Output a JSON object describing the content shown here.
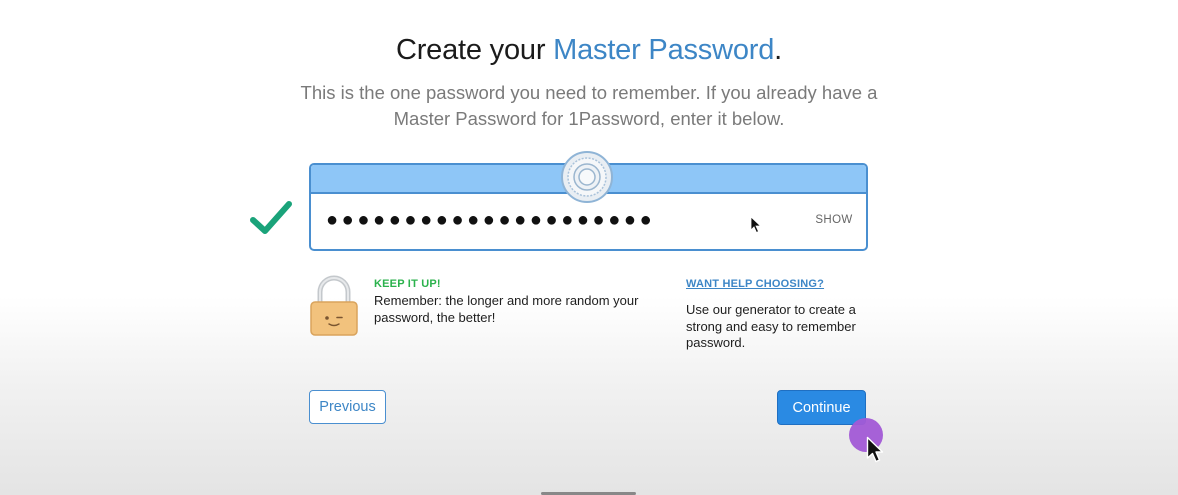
{
  "header": {
    "title_prefix": "Create your ",
    "title_accent": "Master Password",
    "title_suffix": ".",
    "subtitle": "This is the one password you need to remember. If you already have a Master Password for 1Password, enter it below."
  },
  "password_field": {
    "value_masked": "●●●●●●●●●●●●●●●●●●●●●",
    "show_label": "SHOW",
    "strength_status": "valid"
  },
  "tip": {
    "heading": "KEEP IT UP!",
    "body": "Remember: the longer and more random your password, the better!"
  },
  "help": {
    "link": "WANT HELP CHOOSING?",
    "body": "Use our generator to create a strong and easy to remember password."
  },
  "buttons": {
    "previous": "Previous",
    "continue": "Continue"
  },
  "colors": {
    "accent": "#3d86c6",
    "success": "#2bb24c",
    "check": "#1aa37a",
    "primary_button": "#2a8ae3",
    "field_header": "#8ec6f7",
    "click_indicator": "#a25ad6"
  },
  "icons": {
    "check": "checkmark-icon",
    "dial": "vault-dial-icon",
    "lock": "smiling-lock-icon",
    "cursor": "mouse-pointer-icon"
  }
}
